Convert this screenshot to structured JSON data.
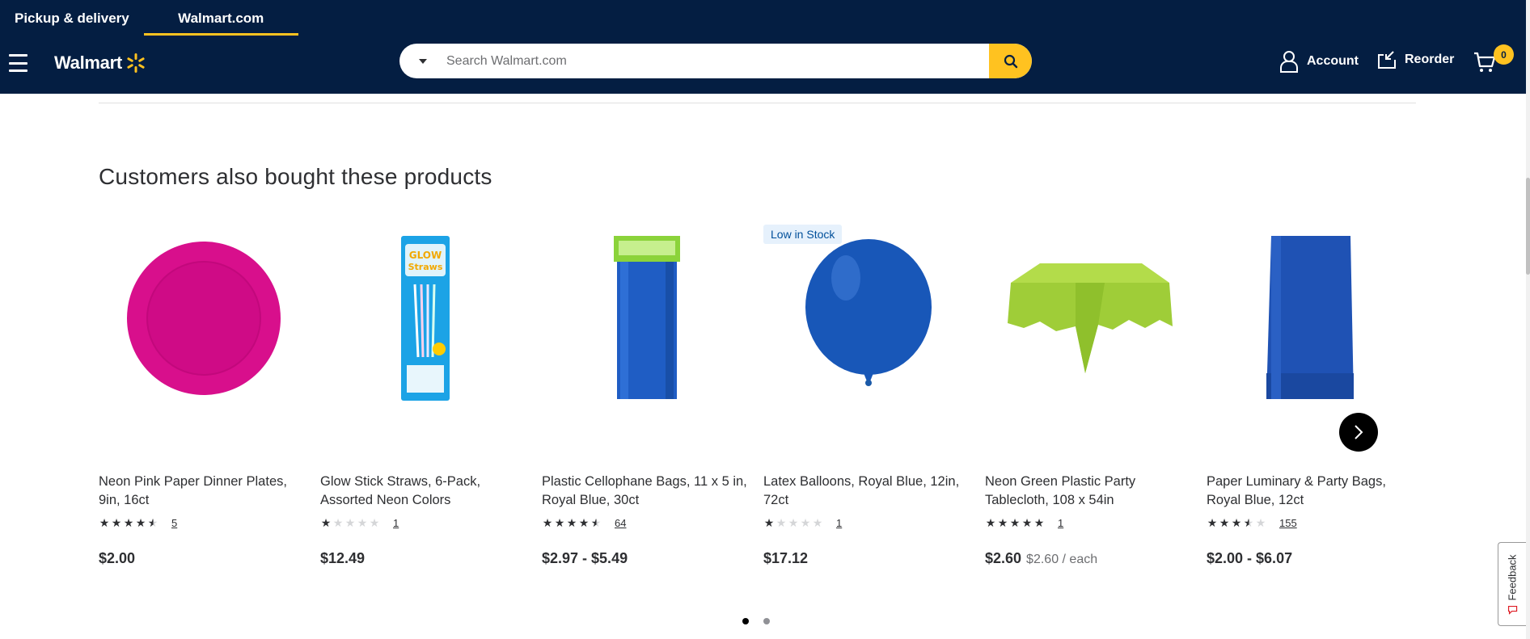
{
  "header": {
    "tabs": [
      {
        "label": "Pickup & delivery",
        "active": false
      },
      {
        "label": "Walmart.com",
        "active": true
      }
    ],
    "logo_text": "Walmart",
    "search": {
      "placeholder": "Search Walmart.com",
      "value": ""
    },
    "account_label": "Account",
    "reorder_label": "Reorder",
    "cart_count": "0",
    "colors": {
      "navy": "#041e42",
      "yellow": "#ffc220"
    }
  },
  "section": {
    "title": "Customers also bought these products"
  },
  "products": [
    {
      "title": "Neon Pink Paper Dinner Plates, 9in, 16ct",
      "rating": 4.5,
      "review_count": "5",
      "price": "$2.00",
      "unit_price": "",
      "badge": "",
      "image": "pink-plate"
    },
    {
      "title": "Glow Stick Straws, 6-Pack, Assorted Neon Colors",
      "rating": 1,
      "review_count": "1",
      "price": "$12.49",
      "unit_price": "",
      "badge": "",
      "image": "glow-straws"
    },
    {
      "title": "Plastic Cellophane Bags, 11 x 5 in, Royal Blue, 30ct",
      "rating": 4.5,
      "review_count": "64",
      "price": "$2.97 - $5.49",
      "unit_price": "",
      "badge": "",
      "image": "cello-bags"
    },
    {
      "title": "Latex Balloons, Royal Blue, 12in, 72ct",
      "rating": 1,
      "review_count": "1",
      "price": "$17.12",
      "unit_price": "",
      "badge": "Low in Stock",
      "image": "balloon"
    },
    {
      "title": "Neon Green Plastic Party Tablecloth, 108 x 54in",
      "rating": 5,
      "review_count": "1",
      "price": "$2.60",
      "unit_price": "$2.60 / each",
      "badge": "",
      "image": "tablecloth"
    },
    {
      "title": "Paper Luminary & Party Bags, Royal Blue, 12ct",
      "rating": 3.5,
      "review_count": "155",
      "price": "$2.00 - $6.07",
      "unit_price": "",
      "badge": "",
      "image": "paper-bag"
    }
  ],
  "carousel": {
    "pages": 2,
    "current_page": 1
  },
  "feedback_label": "Feedback"
}
